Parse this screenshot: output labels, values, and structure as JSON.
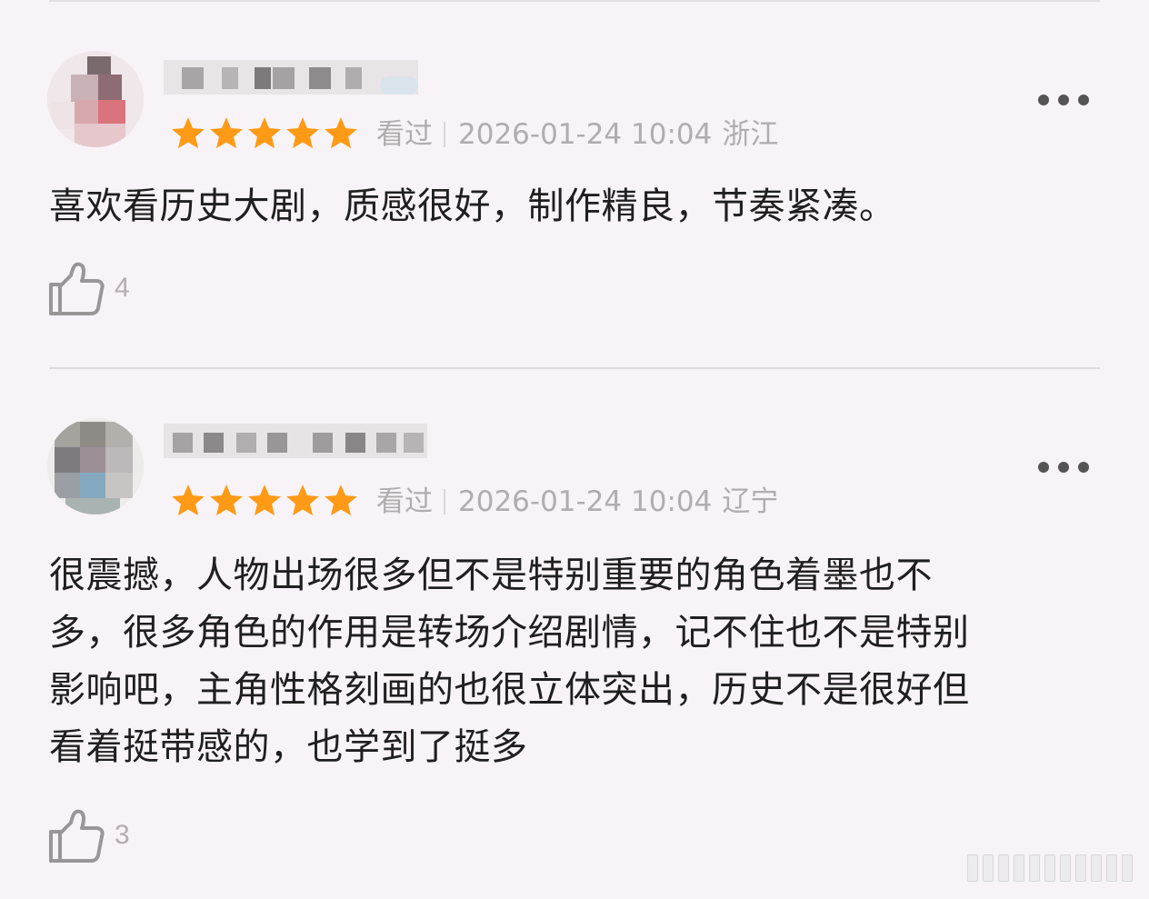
{
  "reviews": [
    {
      "status": "看过",
      "datetime": "2026-01-24 10:04",
      "location": "浙江",
      "rating": 5,
      "text": "喜欢看历史大剧，质感很好，制作精良，节奏紧凑。",
      "likes": "4",
      "icons": {
        "more": "more-icon",
        "like": "thumbs-up-icon",
        "star": "star-icon"
      }
    },
    {
      "status": "看过",
      "datetime": "2026-01-24 10:04",
      "location": "辽宁",
      "rating": 5,
      "text": "很震撼，人物出场很多但不是特别重要的角色着墨也不\n多，很多角色的作用是转场介绍剧情，记不住也不是特别\n影响吧，主角性格刻画的也很立体突出，历史不是很好但\n看着挺带感的，也学到了挺多",
      "likes": "3",
      "icons": {
        "more": "more-icon",
        "like": "thumbs-up-icon",
        "star": "star-icon"
      }
    }
  ],
  "colors": {
    "background": "#f8f3f6",
    "star": "#ff9a16",
    "meta_text": "#b1adaf",
    "body_text": "#1f1f1f"
  }
}
